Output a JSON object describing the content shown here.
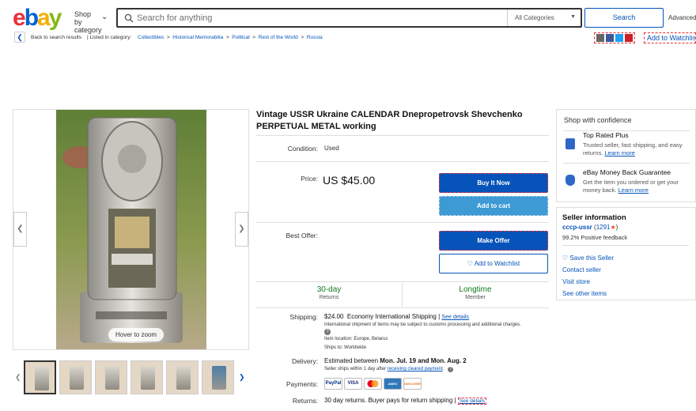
{
  "header": {
    "logo": "ebay",
    "shop_by": "Shop by category",
    "search_placeholder": "Search for anything",
    "category_select": "All Categories",
    "search_button": "Search",
    "advanced": "Advanced"
  },
  "breadcrumb": {
    "back": "Back to search results",
    "listed_in": "| Listed in category:",
    "items": [
      "Collectibles",
      "Historical Memorabilia",
      "Political",
      "Rest of the World",
      "Russia"
    ]
  },
  "watchlist_top": "Add to Watchlist",
  "gallery": {
    "hover_text": "Hover to zoom",
    "thumb_count": 6,
    "selected_index": 0,
    "colors": {
      "bg_green": "#6f8a3a",
      "metal": "#cfccc4"
    }
  },
  "listing": {
    "title": "Vintage USSR Ukraine CALENDAR Dnepropetrovsk Shevchenko PERPETUAL METAL working",
    "condition_label": "Condition:",
    "condition_value": "Used",
    "price_label": "Price:",
    "price_value": "US $45.00",
    "buy_now": "Buy It Now",
    "add_to_cart": "Add to cart",
    "best_offer_label": "Best Offer:",
    "make_offer": "Make Offer",
    "add_to_watchlist": "Add to Watchlist",
    "returns_days": "30-day",
    "returns_label": "Returns",
    "member_duration": "Longtime",
    "member_label": "Member"
  },
  "shipping": {
    "label": "Shipping:",
    "cost": "$24.00",
    "method": "Economy International Shipping |",
    "see_details": "See details",
    "note": "International shipment of items may be subject to customs processing and additional charges.",
    "item_location": "Item location:  Europe, Belarus",
    "ships_to": "Ships to:  Worldwide"
  },
  "delivery": {
    "label": "Delivery:",
    "estimate_prefix": "Estimated between ",
    "estimate_dates": "Mon. Jul. 19 and Mon. Aug. 2",
    "note_prefix": "Seller ships within 1 day after ",
    "note_link": "receiving cleared payment",
    "note_suffix": "."
  },
  "payments": {
    "label": "Payments:",
    "methods": [
      "PayPal",
      "VISA",
      "MC",
      "AMEX",
      "DISCOVER"
    ]
  },
  "returns": {
    "label": "Returns:",
    "text": "30 day returns. Buyer pays for return shipping |",
    "see_details": "See details"
  },
  "confidence": {
    "title": "Shop with confidence",
    "items": [
      {
        "title": "Top Rated Plus",
        "desc": "Trusted seller, fast shipping, and easy returns. ",
        "link": "Learn more"
      },
      {
        "title": "eBay Money Back Guarantee",
        "desc": "Get the item you ordered or get your money back. ",
        "link": "Learn more"
      }
    ]
  },
  "seller": {
    "title": "Seller information",
    "name": "cccp-ussr",
    "score_open": "(",
    "score": "1291",
    "score_close": ")",
    "feedback": "99.2% Positive feedback",
    "save": "Save this Seller",
    "contact": "Contact seller",
    "store": "Visit store",
    "other": "See other items"
  }
}
